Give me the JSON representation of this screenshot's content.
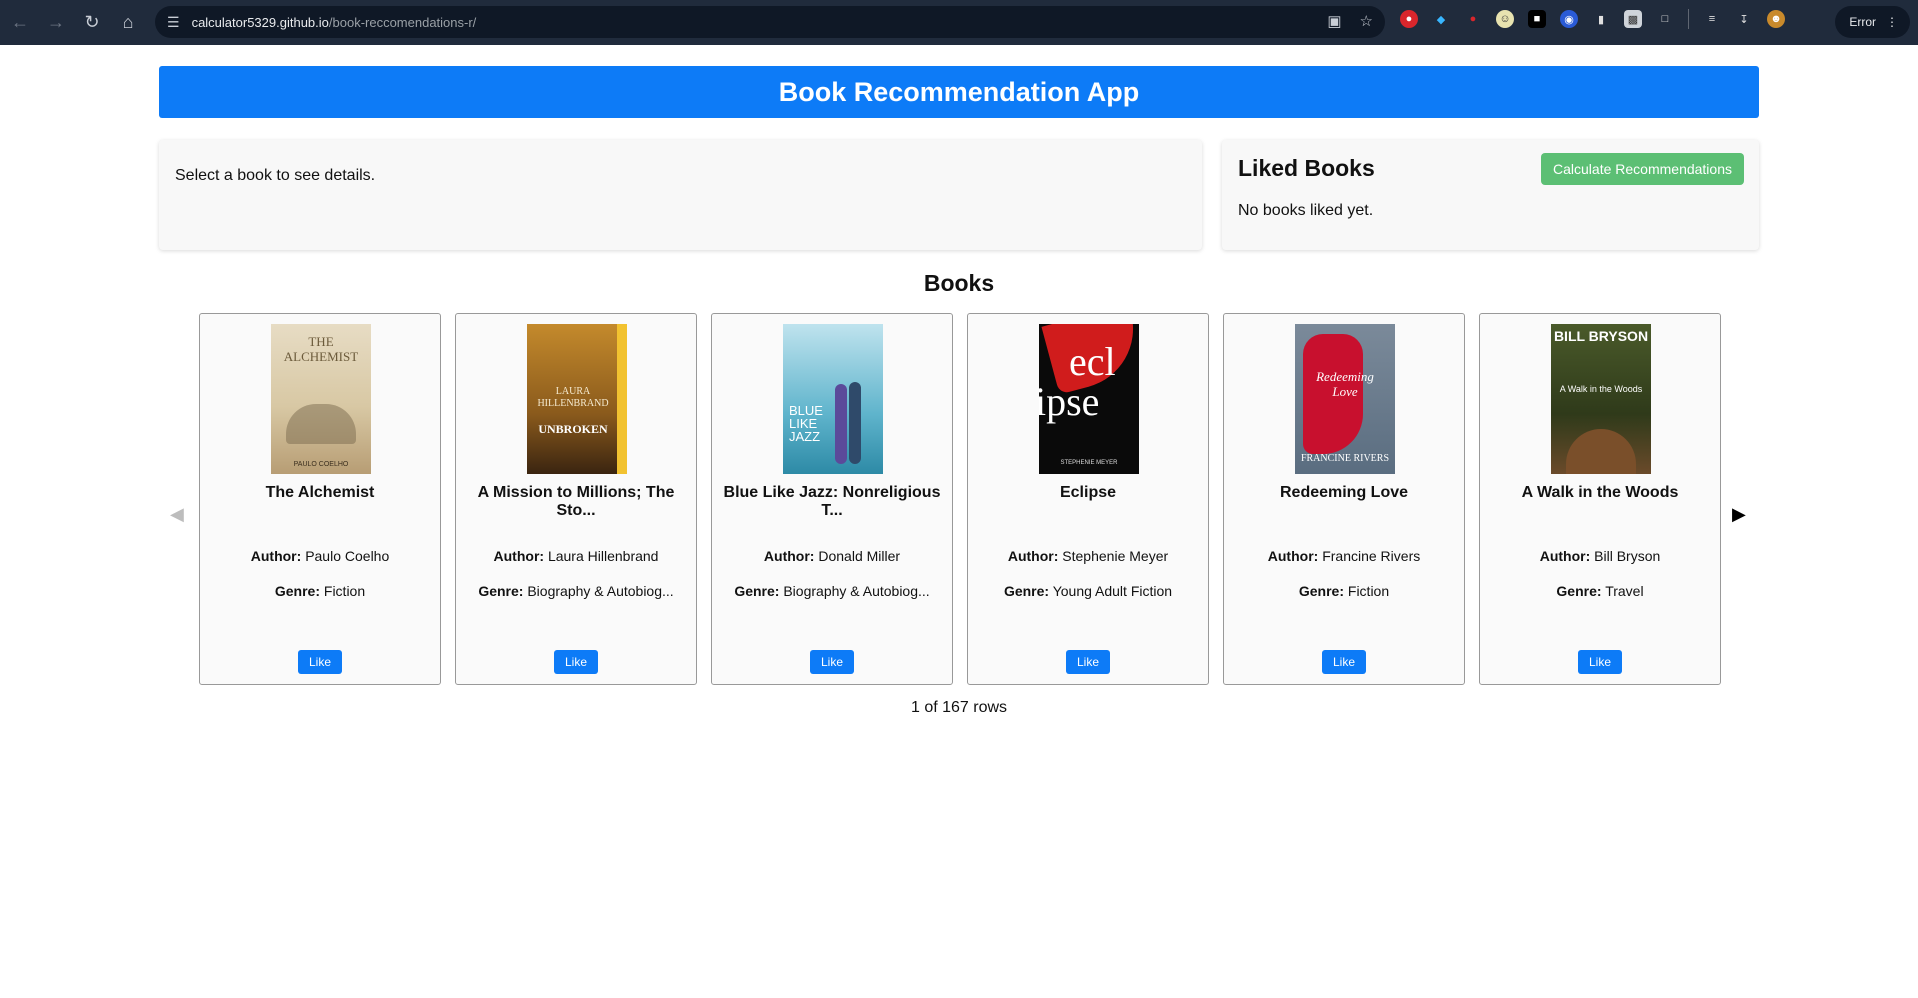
{
  "browser": {
    "url_host": "calculator5329.github.io",
    "url_path": "/book-reccomendations-r/",
    "error_label": "Error"
  },
  "app": {
    "title": "Book Recommendation App",
    "details_placeholder": "Select a book to see details.",
    "liked": {
      "title": "Liked Books",
      "calc_button": "Calculate Recommendations",
      "empty_text": "No books liked yet."
    },
    "books_heading": "Books",
    "author_label": "Author:",
    "genre_label": "Genre:",
    "like_label": "Like",
    "books": [
      {
        "title": "The Alchemist",
        "author": "Paulo Coelho",
        "genre": "Fiction",
        "cover_text_1": "THE",
        "cover_text_2": "ALCHEMIST",
        "cover_text_3": "PAULO COELHO"
      },
      {
        "title": "A Mission to Millions; The Sto...",
        "author": "Laura Hillenbrand",
        "genre": "Biography & Autobiog...",
        "cover_text_1": "LAURA",
        "cover_text_2": "HILLENBRAND",
        "cover_text_3": "UNBROKEN"
      },
      {
        "title": "Blue Like Jazz: Nonreligious T...",
        "author": "Donald Miller",
        "genre": "Biography & Autobiog...",
        "cover_text_1": "BLUE",
        "cover_text_2": "LIKE",
        "cover_text_3": "JAZZ"
      },
      {
        "title": "Eclipse",
        "author": "Stephenie Meyer",
        "genre": "Young Adult Fiction",
        "cover_text_1": "ecl",
        "cover_text_2": "ipse",
        "cover_text_3": "STEPHENIE MEYER"
      },
      {
        "title": "Redeeming Love",
        "author": "Francine Rivers",
        "genre": "Fiction",
        "cover_text_1": "Redeeming",
        "cover_text_2": "Love",
        "cover_text_3": "FRANCINE RIVERS"
      },
      {
        "title": "A Walk in the Woods",
        "author": "Bill Bryson",
        "genre": "Travel",
        "cover_text_1": "BILL BRYSON",
        "cover_text_2": "A Walk in the Woods",
        "cover_text_3": ""
      }
    ],
    "pager_text": "1 of 167 rows"
  },
  "colors": {
    "primary": "#0d7bf7",
    "success": "#5cbf74",
    "chrome_bg": "#202b3c"
  }
}
